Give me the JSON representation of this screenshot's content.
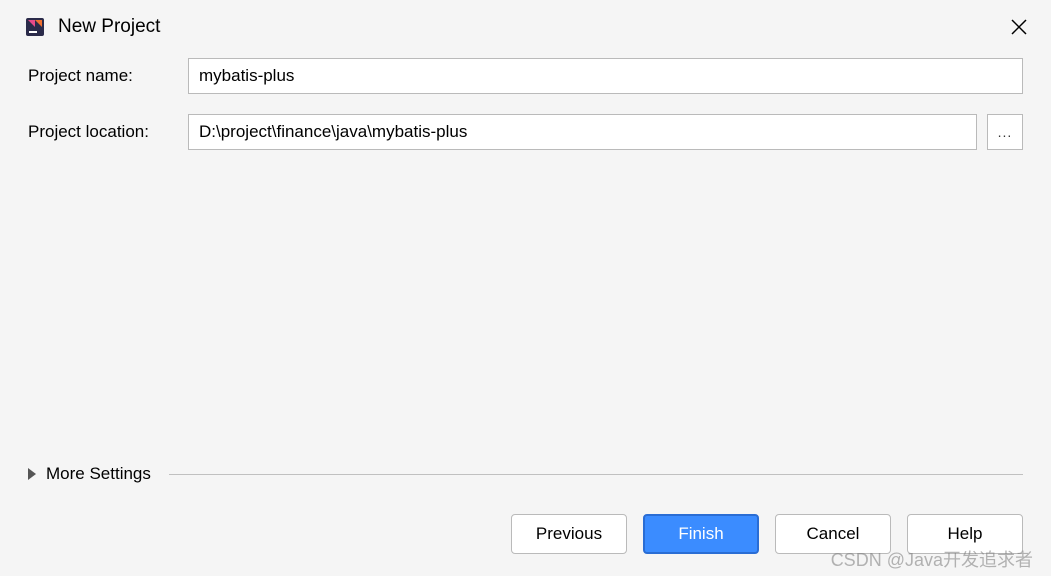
{
  "dialog": {
    "title": "New Project"
  },
  "form": {
    "projectNameLabel": "Project name:",
    "projectNameValue": "mybatis-plus",
    "projectLocationLabel": "Project location:",
    "projectLocationValue": "D:\\project\\finance\\java\\mybatis-plus",
    "browseLabel": "..."
  },
  "moreSettings": {
    "label": "More Settings"
  },
  "buttons": {
    "previous": "Previous",
    "finish": "Finish",
    "cancel": "Cancel",
    "help": "Help"
  },
  "watermark": "CSDN @Java开发追求者"
}
